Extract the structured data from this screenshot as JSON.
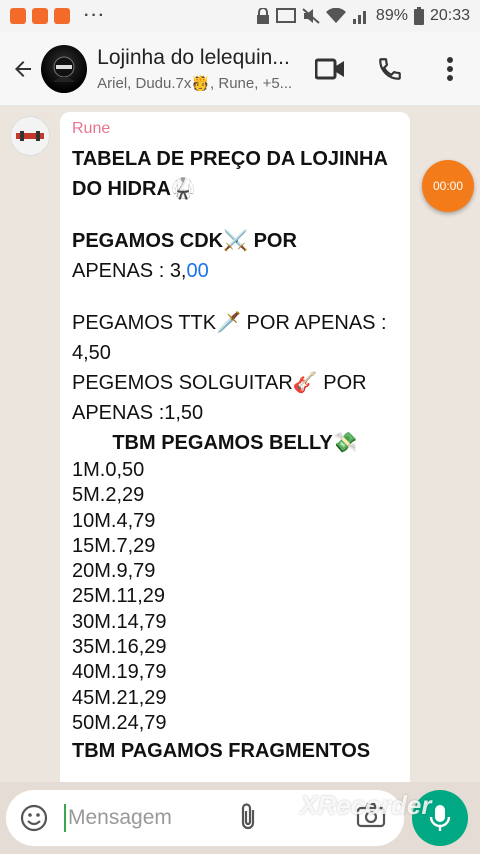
{
  "status_bar": {
    "battery": "89%",
    "time": "20:33",
    "dots": "···"
  },
  "header": {
    "title": "Lojinha do lelequin...",
    "subtitle": "Ariel, Dudu.7x🫅, Rune, +5..."
  },
  "message": {
    "sender": "Rune",
    "title": "TABELA DE PREÇO DA LOJINHA DO HIDRA🥋",
    "cdk_line_1": "PEGAMOS CDK⚔️ POR",
    "cdk_price_prefix": "APENAS : 3,",
    "cdk_price_link": "00",
    "ttk_line": "PEGAMOS TTK🗡️ POR APENAS :",
    "ttk_price": "4,50",
    "solguitar_line": "PEGEMOS SOLGUITAR🎸 POR",
    "solguitar_price": "APENAS :1,50",
    "belly_header": "TBM PEGAMOS BELLY💸",
    "belly_prices": [
      "1M.0,50",
      "5M.2,29",
      "10M.4,79",
      "15M.7,29",
      "20M.9,79",
      "25M.11,29",
      "30M.14,79",
      "35M.16,29",
      "40M.19,79",
      "45M.21,29",
      "50M.24,79"
    ],
    "fragments_header": "TBM PAGAMOS FRAGMENTOS"
  },
  "recorder": {
    "timer": "00:00",
    "watermark": "XRecorder"
  },
  "input": {
    "placeholder": "Mensagem"
  },
  "colors": {
    "accent": "#00a884",
    "sender_name": "#e77592",
    "recorder": "#f47b1a"
  }
}
